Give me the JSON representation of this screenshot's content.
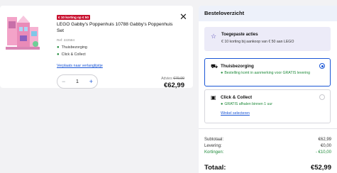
{
  "product": {
    "badge": "€ 10 korting op € 50",
    "title": "LEGO Gabby's Poppenhuis 10788 Gabby's Poppenhuis Set",
    "ref": "Ref: 222584",
    "delivery_options": [
      "Thuisbezorging",
      "Click & Collect"
    ],
    "wishlist_link": "Verplaats naar verlanglijstje",
    "quantity": "1",
    "advies_label": "Advies",
    "advies_price": "€79,99",
    "price": "€62,99"
  },
  "overview": {
    "title": "Besteloverzicht",
    "promo_title": "Toegepaste acties",
    "promo_text": "€ 10 korting bij aankoop van € 50 aan LEGO",
    "home_delivery": {
      "title": "Thuisbezorging",
      "note": "Bestelling komt in aanmerking voor GRATIS levering",
      "selected": true
    },
    "click_collect": {
      "title": "Click & Collect",
      "note": "GRATIS afhalen binnen 1 uur",
      "link": "Winkel selecteren",
      "selected": false
    },
    "subtotal_label": "Subtotaal:",
    "subtotal_value": "€62,99",
    "delivery_label": "Levering:",
    "delivery_value": "€0,00",
    "discount_label": "Kortingen:",
    "discount_value": "- €10,00",
    "total_label": "Totaal:",
    "total_value": "€52,99"
  },
  "icons": {
    "close": "close-icon",
    "promo": "star-icon",
    "truck": "truck-icon",
    "store": "store-icon"
  },
  "colors": {
    "accent": "#1a56d6",
    "badge": "#c8102e",
    "success": "#1f8a3a",
    "promo_bg": "#ecebf8",
    "header_bg": "#edf1fa"
  }
}
